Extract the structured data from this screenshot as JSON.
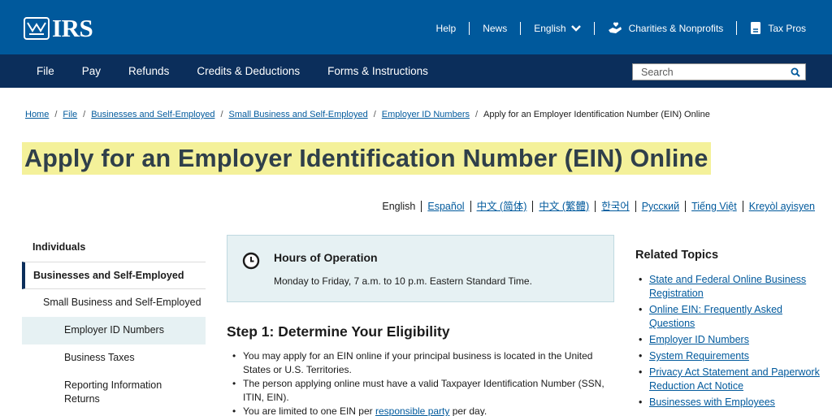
{
  "header": {
    "logo_text": "IRS",
    "utility": [
      {
        "label": "Help"
      },
      {
        "label": "News"
      },
      {
        "label": "English"
      },
      {
        "label": "Charities & Nonprofits"
      },
      {
        "label": "Tax Pros"
      }
    ]
  },
  "nav": {
    "items": [
      "File",
      "Pay",
      "Refunds",
      "Credits & Deductions",
      "Forms & Instructions"
    ],
    "search_placeholder": "Search"
  },
  "breadcrumb": [
    "Home",
    "File",
    "Businesses and Self-Employed",
    "Small Business and Self-Employed",
    "Employer ID Numbers",
    "Apply for an Employer Identification Number (EIN) Online"
  ],
  "page_title": "Apply for an Employer Identification Number (EIN) Online",
  "languages": [
    "English",
    "Español",
    "中文 (简体)",
    "中文 (繁體)",
    "한국어",
    "Русский",
    "Tiếng Việt",
    "Kreyòl ayisyen"
  ],
  "sidebar": {
    "heading": "Individuals",
    "active": "Businesses and Self-Employed",
    "sub": "Small Business and Self-Employed",
    "items": [
      "Employer ID Numbers",
      "Business Taxes",
      "Reporting Information Returns"
    ]
  },
  "hours": {
    "title": "Hours of Operation",
    "text": "Monday to Friday, 7 a.m. to 10 p.m. Eastern Standard Time."
  },
  "step1": {
    "title": "Step 1: Determine Your Eligibility",
    "b1": "You may apply for an EIN online if your principal business is located in the United States or U.S. Territories.",
    "b2": "The person applying online must have a valid Taxpayer Identification Number (SSN, ITIN, EIN).",
    "b3_pre": "You are limited to one EIN per ",
    "b3_link": "responsible party",
    "b3_post": " per day."
  },
  "related": {
    "title": "Related Topics",
    "links": [
      "State and Federal Online Business Registration",
      "Online EIN: Frequently Asked Questions",
      "Employer ID Numbers",
      "System Requirements",
      "Privacy Act Statement and Paperwork Reduction Act Notice",
      "Businesses with Employees"
    ]
  },
  "colors": {
    "header_blue": "#00599c",
    "nav_navy": "#0b2e5b",
    "title_highlight": "#f4f19a",
    "info_box": "#e6f1f3"
  }
}
